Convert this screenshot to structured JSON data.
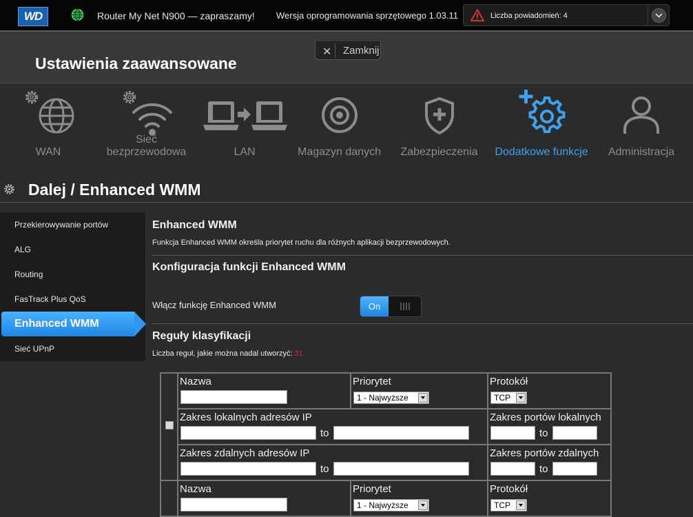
{
  "topbar": {
    "logo": "WD",
    "router_title": "Router My Net N900 — zapraszamy!",
    "firmware": "Wersja oprogramowania sprzętowego 1.03.11",
    "notifications": "Liczba powiadomień: 4"
  },
  "header": {
    "title": "Ustawienia zaawansowane",
    "close_label": "Zamknij"
  },
  "categories": [
    {
      "label": "WAN",
      "icon": "globe-gear-icon"
    },
    {
      "label": "Sieć bezprzewodowa",
      "line1": "Sieć",
      "line2": "bezprzewodowa",
      "icon": "wifi-gear-icon"
    },
    {
      "label": "LAN",
      "icon": "laptops-icon"
    },
    {
      "label": "Magazyn danych",
      "icon": "disc-icon"
    },
    {
      "label": "Zabezpieczenia",
      "icon": "shield-icon"
    },
    {
      "label": "Dodatkowe funkcje",
      "icon": "gear-plus-icon",
      "active": true
    },
    {
      "label": "Administracja",
      "icon": "user-icon"
    }
  ],
  "section_title": "Dalej / Enhanced WMM",
  "sidebar": {
    "items": [
      {
        "label": "Przekierowywanie portów"
      },
      {
        "label": "ALG"
      },
      {
        "label": "Routing"
      },
      {
        "label": "FasTrack Plus QoS"
      },
      {
        "label": "Enhanced WMM",
        "active": true
      },
      {
        "label": "Sieć UPnP"
      }
    ]
  },
  "content": {
    "heading": "Enhanced WMM",
    "description": "Funkcja Enhanced WMM określa priorytet ruchu dla różnych aplikacji bezprzewodowych.",
    "config_heading": "Konfiguracja funkcji Enhanced WMM",
    "enable_label": "Włącz funkcję Enhanced WMM",
    "toggle_on": "On",
    "rules_heading": "Reguły klasyfikacji",
    "remaining_label": "Liczba reguł, jakie można nadal utworzyć: ",
    "remaining_count": "31"
  },
  "rules_table": {
    "name_label": "Nazwa",
    "priority_label": "Priorytet",
    "priority_value": "1 - Najwyższe",
    "protocol_label": "Protokół",
    "protocol_value": "TCP",
    "local_ip_label": "Zakres lokalnych adresów IP",
    "local_port_label": "Zakres portów lokalnych",
    "remote_ip_label": "Zakres zdalnych adresów IP",
    "remote_port_label": "Zakres portów zdalnych",
    "to": "to"
  },
  "colors": {
    "accent": "#3fa1f0",
    "inactive": "#8c8c8c",
    "alert": "#e02a2a"
  }
}
